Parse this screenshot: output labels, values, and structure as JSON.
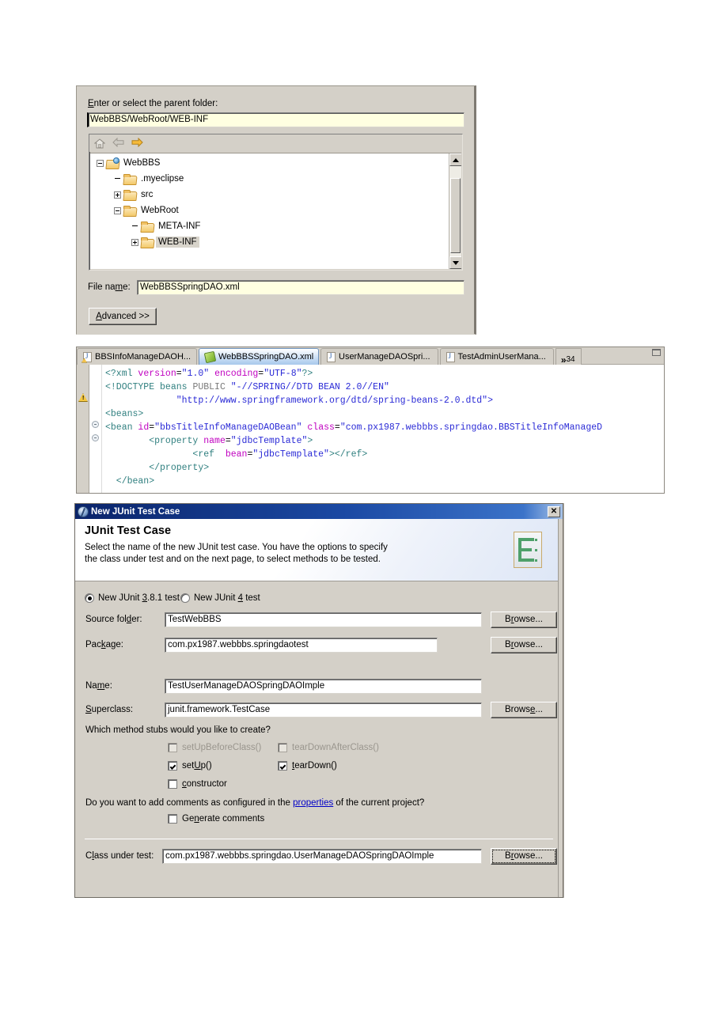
{
  "new_file_panel": {
    "parent_folder_label": "Enter or select the parent folder:",
    "parent_folder_value": "WebBBS/WebRoot/WEB-INF",
    "toolbar": {
      "home_icon": "home-icon",
      "back_icon": "back-arrow-icon",
      "forward_icon": "forward-arrow-icon"
    },
    "tree": [
      {
        "label": "WebBBS",
        "depth": 0,
        "expander": "minus",
        "icon": "project-folder-icon",
        "selected": false
      },
      {
        "label": ".myeclipse",
        "depth": 1,
        "expander": "none",
        "icon": "folder-icon",
        "selected": false
      },
      {
        "label": "src",
        "depth": 1,
        "expander": "plus",
        "icon": "folder-icon",
        "selected": false
      },
      {
        "label": "WebRoot",
        "depth": 1,
        "expander": "minus",
        "icon": "folder-icon",
        "selected": false
      },
      {
        "label": "META-INF",
        "depth": 2,
        "expander": "none",
        "icon": "folder-icon",
        "selected": false
      },
      {
        "label": "WEB-INF",
        "depth": 2,
        "expander": "plus",
        "icon": "folder-icon",
        "selected": true
      }
    ],
    "file_name_label": "File name:",
    "file_name_value": "WebBBSSpringDAO.xml",
    "advanced_button": "Advanced >>"
  },
  "editor_panel": {
    "tabs": [
      {
        "label": "BBSInfoManageDAOH...",
        "icon": "java-file-icon",
        "active": false,
        "closable": false,
        "warning": true
      },
      {
        "label": "WebBBSSpringDAO.xml",
        "icon": "xml-file-icon",
        "active": true,
        "closable": true,
        "warning": false
      },
      {
        "label": "UserManageDAOSpri...",
        "icon": "java-file-icon",
        "active": false,
        "closable": false,
        "warning": false
      },
      {
        "label": "TestAdminUserMana...",
        "icon": "java-file-icon",
        "active": false,
        "closable": false,
        "warning": false
      }
    ],
    "more_tabs_chevron": "»",
    "more_tabs_count": "34",
    "code_lines": [
      [
        {
          "t": "<?xml ",
          "c": "c-tag"
        },
        {
          "t": "version",
          "c": "c-attr"
        },
        {
          "t": "=",
          "c": "c-txt"
        },
        {
          "t": "\"1.0\"",
          "c": "c-val"
        },
        {
          "t": " ",
          "c": "c-txt"
        },
        {
          "t": "encoding",
          "c": "c-attr"
        },
        {
          "t": "=",
          "c": "c-txt"
        },
        {
          "t": "\"UTF-8\"",
          "c": "c-val"
        },
        {
          "t": "?>",
          "c": "c-tag"
        }
      ],
      [
        {
          "t": "<!DOCTYPE ",
          "c": "c-tag"
        },
        {
          "t": "beans ",
          "c": "c-tag"
        },
        {
          "t": "PUBLIC ",
          "c": "c-kw"
        },
        {
          "t": "\"-//SPRING//DTD BEAN 2.0//EN\"",
          "c": "c-val"
        }
      ],
      [
        {
          "t": "             ",
          "c": "c-txt"
        },
        {
          "t": "\"http://www.springframework.org/dtd/spring-beans-2.0.dtd\">",
          "c": "c-val"
        }
      ],
      [
        {
          "t": "<beans>",
          "c": "c-tag"
        }
      ],
      [
        {
          "t": "<bean ",
          "c": "c-tag"
        },
        {
          "t": "id",
          "c": "c-attr"
        },
        {
          "t": "=",
          "c": "c-txt"
        },
        {
          "t": "\"bbsTitleInfoManageDAOBean\"",
          "c": "c-val"
        },
        {
          "t": " ",
          "c": "c-txt"
        },
        {
          "t": "class",
          "c": "c-attr"
        },
        {
          "t": "=",
          "c": "c-txt"
        },
        {
          "t": "\"com.px1987.webbbs.springdao.BBSTitleInfoManageD",
          "c": "c-val"
        }
      ],
      [
        {
          "t": "        <property ",
          "c": "c-tag"
        },
        {
          "t": "name",
          "c": "c-attr"
        },
        {
          "t": "=",
          "c": "c-txt"
        },
        {
          "t": "\"jdbcTemplate\"",
          "c": "c-val"
        },
        {
          "t": ">",
          "c": "c-tag"
        }
      ],
      [
        {
          "t": "                <ref  ",
          "c": "c-tag"
        },
        {
          "t": "bean",
          "c": "c-attr"
        },
        {
          "t": "=",
          "c": "c-txt"
        },
        {
          "t": "\"jdbcTemplate\"",
          "c": "c-val"
        },
        {
          "t": "></ref>",
          "c": "c-tag"
        }
      ],
      [
        {
          "t": "        </property>",
          "c": "c-tag"
        }
      ],
      [
        {
          "t": "  </bean>",
          "c": "c-tag"
        }
      ]
    ]
  },
  "junit_dialog": {
    "window_title": "New JUnit Test Case",
    "close_label": "✕",
    "heading": "JUnit Test Case",
    "description_line1": "Select the name of the new JUnit test case. You have the options to specify",
    "description_line2": "the class under test and on the next page, to select methods to be tested.",
    "radio_junit38_label": "New JUnit 3.8.1 test",
    "radio_junit38_selected": true,
    "radio_junit4_label": "New JUnit 4 test",
    "radio_junit4_selected": false,
    "source_folder_label": "Source folder:",
    "source_folder_value": "TestWebBBS",
    "source_folder_browse": "Browse...",
    "package_label": "Package:",
    "package_value": "com.px1987.webbbs.springdaotest",
    "package_browse": "Browse...",
    "name_label": "Name:",
    "name_value": "TestUserManageDAOSpringDAOImple",
    "superclass_label": "Superclass:",
    "superclass_value": "junit.framework.TestCase",
    "superclass_browse": "Browse...",
    "stubs_question": "Which method stubs would you like to create?",
    "stubs": [
      {
        "label": "setUpBeforeClass()",
        "checked": false,
        "disabled": true
      },
      {
        "label": "tearDownAfterClass()",
        "checked": false,
        "disabled": true
      },
      {
        "label": "setUp()",
        "checked": true,
        "disabled": false
      },
      {
        "label": "tearDown()",
        "checked": true,
        "disabled": false
      },
      {
        "label": "constructor",
        "checked": false,
        "disabled": false
      }
    ],
    "comments_question_before": "Do you want to add comments as configured in the ",
    "comments_link": "properties",
    "comments_question_after": " of the current project?",
    "generate_comments_label": "Generate comments",
    "generate_comments_checked": false,
    "class_under_test_label": "Class under test:",
    "class_under_test_value": "com.px1987.webbbs.springdao.UserManageDAOSpringDAOImple",
    "class_under_test_browse": "Browse..."
  }
}
